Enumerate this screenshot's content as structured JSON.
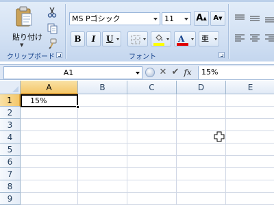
{
  "clipboard": {
    "paste_label": "貼り付け",
    "group_label": "クリップボード"
  },
  "font": {
    "font_name": "MS Pゴシック",
    "font_size": "11",
    "grow_label": "A",
    "shrink_label": "A",
    "bold_label": "B",
    "italic_label": "I",
    "underline_label": "U",
    "font_color_label": "A",
    "phonetic_label": "亜",
    "group_label": "フォント"
  },
  "formula_bar": {
    "name_box": "A1",
    "fx_label": "fx",
    "formula": "15%"
  },
  "grid": {
    "columns": [
      "A",
      "B",
      "C",
      "D",
      "E"
    ],
    "rows": [
      "1",
      "2",
      "3",
      "4",
      "5",
      "6",
      "7",
      "8",
      "9"
    ],
    "active_column": "A",
    "active_row": "1",
    "active_cell_value": "15%"
  },
  "colors": {
    "font_color_bar": "#e00000",
    "fill_color_bar": "#ffff00",
    "accent": "#15428b"
  }
}
